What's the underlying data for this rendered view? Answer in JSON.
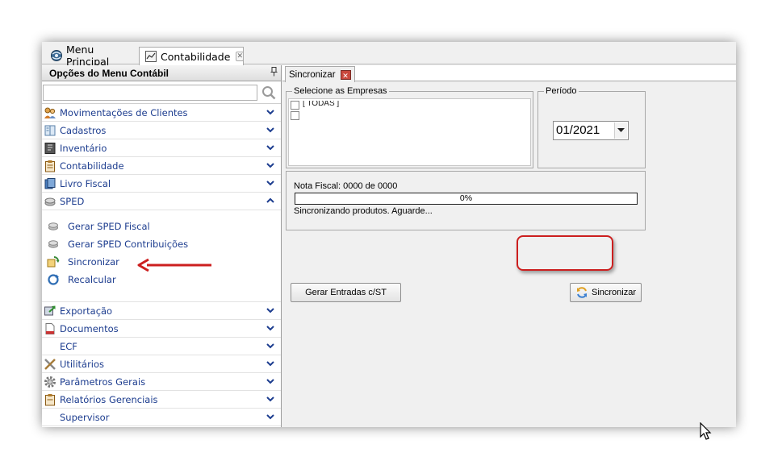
{
  "tabs": [
    {
      "label": "Menu Principal",
      "icon": "globe-icon"
    },
    {
      "label": "Contabilidade",
      "icon": "ledger-icon",
      "close_icon": "close-icon"
    }
  ],
  "sidebar": {
    "title": "Opções do Menu Contábil",
    "pin_icon": "pin-icon",
    "search": {
      "placeholder": "",
      "value": "",
      "icon": "search-icon"
    },
    "items": [
      {
        "label": "Movimentações de Clientes",
        "icon": "users-icon",
        "expanded": false
      },
      {
        "label": "Cadastros",
        "icon": "book-icon",
        "expanded": false
      },
      {
        "label": "Inventário",
        "icon": "inventory-icon",
        "expanded": false
      },
      {
        "label": "Contabilidade",
        "icon": "clipboard-icon",
        "expanded": false
      },
      {
        "label": "Livro Fiscal",
        "icon": "books-icon",
        "expanded": false
      },
      {
        "label": "SPED",
        "icon": "coins-icon",
        "expanded": true
      }
    ],
    "sped_items": [
      {
        "label": "Gerar SPED Fiscal",
        "icon": "coins-icon"
      },
      {
        "label": "Gerar SPED Contribuições",
        "icon": "coins-icon"
      },
      {
        "label": "Sincronizar",
        "icon": "sync-icon"
      },
      {
        "label": "Recalcular",
        "icon": "recalc-icon"
      }
    ],
    "items_after": [
      {
        "label": "Exportação",
        "icon": "export-icon"
      },
      {
        "label": "Documentos",
        "icon": "document-icon"
      },
      {
        "label": "ECF",
        "icon": ""
      },
      {
        "label": "Utilitários",
        "icon": "tools-icon"
      },
      {
        "label": "Parâmetros Gerais",
        "icon": "gear-icon"
      },
      {
        "label": "Relatórios Gerenciais",
        "icon": "report-icon"
      },
      {
        "label": "Supervisor",
        "icon": ""
      }
    ]
  },
  "main": {
    "tab_label": "Sincronizar",
    "empresas_legend": "Selecione as Empresas",
    "empresas_first_item": "[ TODAS ]",
    "periodo_legend": "Período",
    "periodo_value": "01/2021",
    "nota_fiscal_label": "Nota Fiscal: 0000 de 0000",
    "progress_percent": 0,
    "progress_text": "0%",
    "status_text": "Sincronizando produtos. Aguarde...",
    "gerar_button": "Gerar Entradas c/ST",
    "sincronizar_button": "Sincronizar"
  },
  "colors": {
    "menu_text": "#1d3d8f",
    "annotation_red": "#cc1f1f",
    "progress_fill": "#3b9c3b"
  }
}
